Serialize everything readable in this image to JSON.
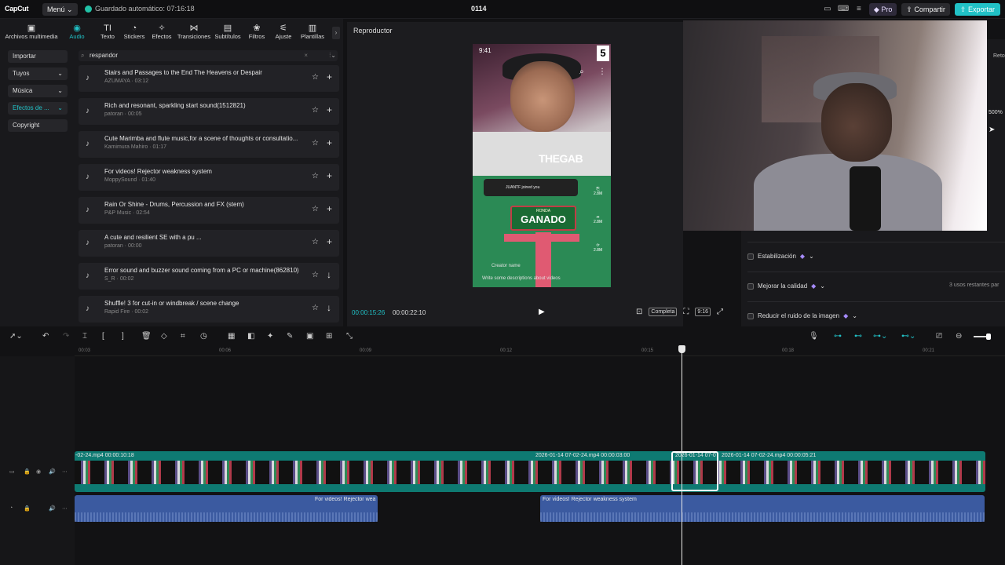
{
  "topbar": {
    "logo": "CapCut",
    "menu_label": "Menú",
    "autosave": "Guardado automático: 07:16:18",
    "project_name": "0114",
    "pro_label": "Pro",
    "share_label": "Compartir",
    "export_label": "Exportar"
  },
  "tabs": [
    {
      "label": "Archivos multimedia",
      "icon": "media-icon"
    },
    {
      "label": "Audio",
      "icon": "audio-icon"
    },
    {
      "label": "Texto",
      "icon": "text-icon"
    },
    {
      "label": "Stickers",
      "icon": "sticker-icon"
    },
    {
      "label": "Efectos",
      "icon": "effects-icon"
    },
    {
      "label": "Transiciones",
      "icon": "transitions-icon"
    },
    {
      "label": "Subtítulos",
      "icon": "subtitles-icon"
    },
    {
      "label": "Filtros",
      "icon": "filters-icon"
    },
    {
      "label": "Ajuste",
      "icon": "adjust-icon"
    },
    {
      "label": "Plantillas",
      "icon": "templates-icon"
    }
  ],
  "active_tab": "Audio",
  "sidebar": {
    "items": [
      {
        "label": "Importar",
        "caret": ""
      },
      {
        "label": "Tuyos",
        "caret": "⌄"
      },
      {
        "label": "Música",
        "caret": "⌄"
      },
      {
        "label": "Efectos de ...",
        "caret": "⌄"
      },
      {
        "label": "Copyright",
        "caret": ""
      }
    ]
  },
  "search": {
    "value": "respandor"
  },
  "sounds": [
    {
      "title": "Stairs and Passages to the End The Heavens or Despair",
      "meta": "AZUMAYA · 03:12",
      "action": "+"
    },
    {
      "title": "Rich and resonant, sparkling start sound(1512821)",
      "meta": "patoran · 00:05",
      "action": "+"
    },
    {
      "title": "Cute Marimba and flute music,for a scene of thoughts or consultatio...",
      "meta": "Kamimura Mahiro · 01:17",
      "action": "+"
    },
    {
      "title": "For videos! Rejector weakness system",
      "meta": "MoppySound · 01:40",
      "action": "+"
    },
    {
      "title": "Rain Or Shine - Drums, Percussion and FX (stem)",
      "meta": "P&P Music · 02:54",
      "action": "+"
    },
    {
      "title": "A cute and resilient SE with a pu ...",
      "meta": "patoran · 00:00",
      "action": "+"
    },
    {
      "title": "Error sound and buzzer sound coming from a PC or machine(862810)",
      "meta": "S_R · 00:02",
      "action": "↓"
    },
    {
      "title": "Shuffle! 3 for cut-in or windbreak / scene change",
      "meta": "Rapid Fire · 00:02",
      "action": "↓"
    }
  ],
  "player": {
    "title": "Reproductor",
    "current_time": "00:00:15:26",
    "total_time": "00:00:22:10",
    "full_label": "Completa",
    "ratio_label": "9:16",
    "phone_time": "9:41",
    "badge_number": "5",
    "watermark": "THEGAB",
    "joined_text": "JUANTF joined you",
    "ronda_label": "RONDA",
    "ganado_label": "GANADO",
    "creator_name": "Creator name",
    "description": "Write some descriptions about videos",
    "side_counts": [
      "2.8M",
      "2.8M",
      "2.8M"
    ]
  },
  "right_panel": {
    "estabilizacion": "Estabilización",
    "mejorar": "Mejorar la calidad",
    "usos": "3 usos restantes par",
    "reducir": "Reducir el ruido de la imagen",
    "retoque": "Reto",
    "percent": "500%"
  },
  "timeline": {
    "ticks": [
      "00:03",
      "00:06",
      "00:09",
      "00:12",
      "00:15",
      "00:18",
      "00:21"
    ],
    "video_labels": [
      "-02-24.mp4   00:00:10:18",
      "2026-01-14 07-02-24.mp4   00:00:03:00",
      "2026-01-14 07-0",
      "2026-01-14 07-02-24.mp4   00:00:05:21"
    ],
    "audio_labels": [
      "For videos! Rejector wea",
      "For videos! Rejector weakness system"
    ]
  },
  "colors": {
    "accent": "#21c1c6",
    "video_track": "#0e7a72",
    "audio_track": "#3b5aa0"
  }
}
